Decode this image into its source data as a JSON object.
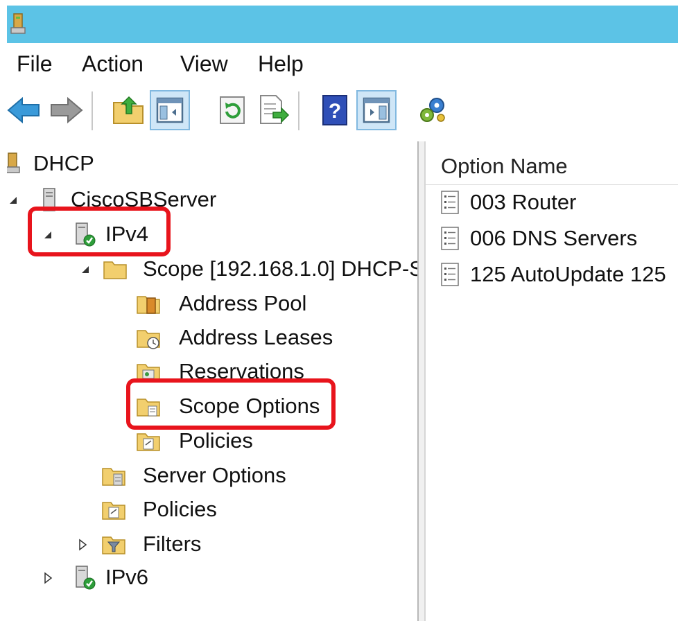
{
  "menu": {
    "file": "File",
    "action": "Action",
    "view": "View",
    "help": "Help"
  },
  "toolbar": {
    "buttons": [
      {
        "name": "back",
        "icon": "back-arrow-icon"
      },
      {
        "name": "forward",
        "icon": "forward-arrow-icon"
      },
      {
        "name": "up-one-level",
        "icon": "up-folder-icon"
      },
      {
        "name": "show-hide-console-tree",
        "icon": "console-tree-icon"
      },
      {
        "name": "refresh",
        "icon": "refresh-icon"
      },
      {
        "name": "export-list",
        "icon": "export-list-icon"
      },
      {
        "name": "help",
        "icon": "help-icon"
      },
      {
        "name": "show-hide-action-pane",
        "icon": "action-pane-icon"
      },
      {
        "name": "run-wizard",
        "icon": "gears-icon"
      }
    ]
  },
  "tree": {
    "root": "DHCP",
    "server": "CiscoSBServer",
    "ipv4": "IPv4",
    "scope": "Scope [192.168.1.0] DHCP-S",
    "address_pool": "Address Pool",
    "address_leases": "Address Leases",
    "reservations": "Reservations",
    "scope_options": "Scope Options",
    "scope_policies": "Policies",
    "server_options": "Server Options",
    "policies": "Policies",
    "filters": "Filters",
    "ipv6": "IPv6"
  },
  "list": {
    "column_header": "Option Name",
    "rows": [
      {
        "label": "003 Router"
      },
      {
        "label": "006 DNS Servers"
      },
      {
        "label": "125 AutoUpdate 125"
      }
    ]
  },
  "colors": {
    "titlebar": "#5cc3e6",
    "highlight": "#e8141c",
    "folder": "#f2cf6e"
  }
}
